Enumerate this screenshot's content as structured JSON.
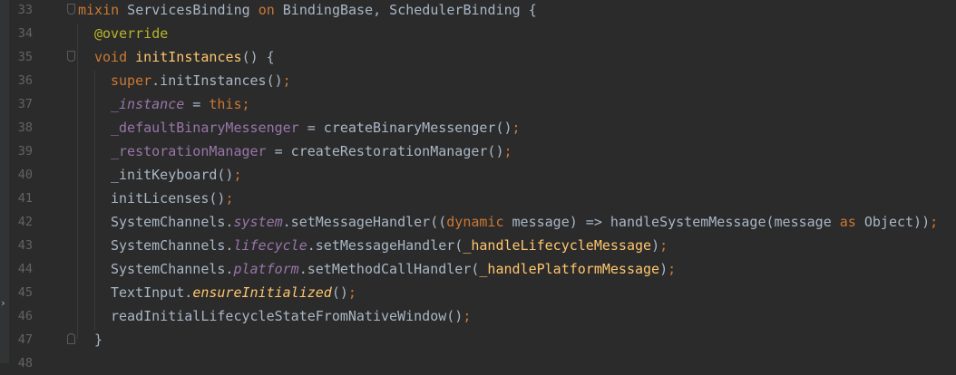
{
  "editor": {
    "lines": [
      {
        "number": "33",
        "fold": "open",
        "indent": 0,
        "tokens": [
          {
            "t": "mixin",
            "c": "kw"
          },
          {
            "t": " ServicesBinding ",
            "c": "cls"
          },
          {
            "t": "on",
            "c": "kw"
          },
          {
            "t": " BindingBase, SchedulerBinding {",
            "c": "cls"
          }
        ]
      },
      {
        "number": "34",
        "fold": "",
        "indent": 1,
        "tokens": [
          {
            "t": "@override",
            "c": "ann"
          }
        ]
      },
      {
        "number": "35",
        "fold": "open",
        "indent": 1,
        "tokens": [
          {
            "t": "void",
            "c": "kw"
          },
          {
            "t": " ",
            "c": "pl"
          },
          {
            "t": "initInstances",
            "c": "fn"
          },
          {
            "t": "() {",
            "c": "pl"
          }
        ]
      },
      {
        "number": "36",
        "fold": "",
        "indent": 2,
        "tokens": [
          {
            "t": "super",
            "c": "kw"
          },
          {
            "t": ".initInstances()",
            "c": "pl"
          },
          {
            "t": ";",
            "c": "kw"
          }
        ]
      },
      {
        "number": "37",
        "fold": "",
        "indent": 2,
        "tokens": [
          {
            "t": "_instance",
            "c": "pr"
          },
          {
            "t": " = ",
            "c": "pl"
          },
          {
            "t": "this",
            "c": "kw"
          },
          {
            "t": ";",
            "c": "kw"
          }
        ]
      },
      {
        "number": "38",
        "fold": "",
        "indent": 2,
        "tokens": [
          {
            "t": "_defaultBinaryMessenger",
            "c": "pv"
          },
          {
            "t": " = createBinaryMessenger()",
            "c": "pl"
          },
          {
            "t": ";",
            "c": "kw"
          }
        ]
      },
      {
        "number": "39",
        "fold": "",
        "indent": 2,
        "tokens": [
          {
            "t": "_restorationManager",
            "c": "pv"
          },
          {
            "t": " = createRestorationManager()",
            "c": "pl"
          },
          {
            "t": ";",
            "c": "kw"
          }
        ]
      },
      {
        "number": "40",
        "fold": "",
        "indent": 2,
        "tokens": [
          {
            "t": "_initKeyboard()",
            "c": "pl"
          },
          {
            "t": ";",
            "c": "kw"
          }
        ]
      },
      {
        "number": "41",
        "fold": "",
        "indent": 2,
        "tokens": [
          {
            "t": "initLicenses()",
            "c": "pl"
          },
          {
            "t": ";",
            "c": "kw"
          }
        ]
      },
      {
        "number": "42",
        "fold": "",
        "indent": 2,
        "tokens": [
          {
            "t": "SystemChannels.",
            "c": "pl"
          },
          {
            "t": "system",
            "c": "pr"
          },
          {
            "t": ".setMessageHandler((",
            "c": "pl"
          },
          {
            "t": "dynamic",
            "c": "kw"
          },
          {
            "t": " message) => handleSystemMessage(message ",
            "c": "pl"
          },
          {
            "t": "as",
            "c": "kw"
          },
          {
            "t": " Object))",
            "c": "pl"
          },
          {
            "t": ";",
            "c": "kw"
          }
        ]
      },
      {
        "number": "43",
        "fold": "",
        "indent": 2,
        "tokens": [
          {
            "t": "SystemChannels.",
            "c": "pl"
          },
          {
            "t": "lifecycle",
            "c": "pr"
          },
          {
            "t": ".setMessageHandler(",
            "c": "pl"
          },
          {
            "t": "_handleLifecycleMessage",
            "c": "fn"
          },
          {
            "t": ")",
            "c": "pl"
          },
          {
            "t": ";",
            "c": "kw"
          }
        ]
      },
      {
        "number": "44",
        "fold": "",
        "indent": 2,
        "tokens": [
          {
            "t": "SystemChannels.",
            "c": "pl"
          },
          {
            "t": "platform",
            "c": "pr"
          },
          {
            "t": ".setMethodCallHandler(",
            "c": "pl"
          },
          {
            "t": "_handlePlatformMessage",
            "c": "fn"
          },
          {
            "t": ")",
            "c": "pl"
          },
          {
            "t": ";",
            "c": "kw"
          }
        ]
      },
      {
        "number": "45",
        "fold": "",
        "indent": 2,
        "tokens": [
          {
            "t": "TextInput.",
            "c": "pl"
          },
          {
            "t": "ensureInitialized",
            "c": "it"
          },
          {
            "t": "()",
            "c": "pl"
          },
          {
            "t": ";",
            "c": "kw"
          }
        ]
      },
      {
        "number": "46",
        "fold": "",
        "indent": 2,
        "tokens": [
          {
            "t": "readInitialLifecycleStateFromNativeWindow()",
            "c": "pl"
          },
          {
            "t": ";",
            "c": "kw"
          }
        ]
      },
      {
        "number": "47",
        "fold": "close",
        "indent": 1,
        "tokens": [
          {
            "t": "}",
            "c": "pl"
          }
        ]
      },
      {
        "number": "48",
        "fold": "",
        "indent": 0,
        "tokens": []
      }
    ]
  }
}
